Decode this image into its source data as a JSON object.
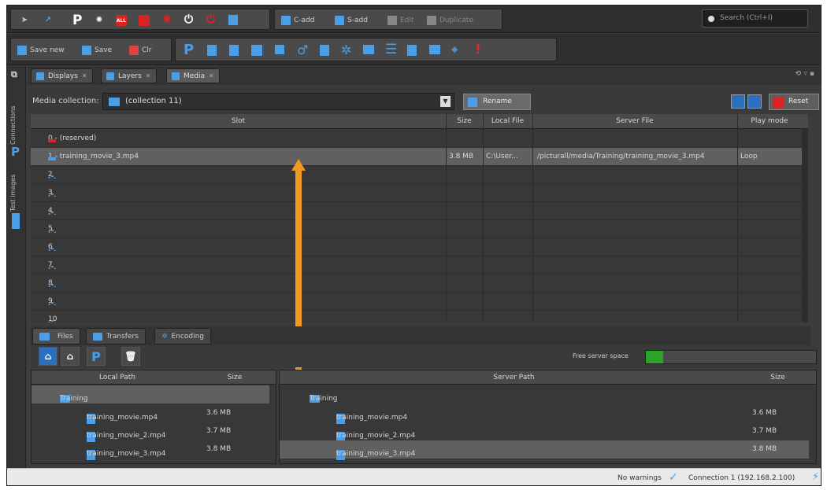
{
  "toolbar": {
    "row1_buttons": [
      "C-add",
      "S-add",
      "Edit",
      "Duplicate"
    ],
    "search_placeholder": "Search (Ctrl+I)",
    "row2_buttons": [
      "Save new",
      "Save",
      "Clr"
    ]
  },
  "sidebar": {
    "tabs": [
      "Connections",
      "Test images"
    ]
  },
  "main_tabs": [
    {
      "label": "Displays",
      "active": false
    },
    {
      "label": "Layers",
      "active": false
    },
    {
      "label": "Media",
      "active": true
    }
  ],
  "media_collection": {
    "label": "Media collection:",
    "value": "(collection 11)",
    "rename_label": "Rename",
    "reset_label": "Reset"
  },
  "slot_table": {
    "headers": [
      "Slot",
      "Size",
      "Local File",
      "Server File",
      "Play mode"
    ],
    "rows": [
      {
        "slot": "0 - (reserved)",
        "size": "",
        "local": "",
        "server": "",
        "mode": ""
      },
      {
        "slot": "1 - training_movie_3.mp4",
        "size": "3.8 MB",
        "local": "C:\\User...",
        "server": "/picturall/media/Training/training_movie_3.mp4",
        "mode": "Loop"
      },
      {
        "slot": "2",
        "size": "",
        "local": "",
        "server": "",
        "mode": ""
      },
      {
        "slot": "3",
        "size": "",
        "local": "",
        "server": "",
        "mode": ""
      },
      {
        "slot": "4",
        "size": "",
        "local": "",
        "server": "",
        "mode": ""
      },
      {
        "slot": "5",
        "size": "",
        "local": "",
        "server": "",
        "mode": ""
      },
      {
        "slot": "6",
        "size": "",
        "local": "",
        "server": "",
        "mode": ""
      },
      {
        "slot": "7",
        "size": "",
        "local": "",
        "server": "",
        "mode": ""
      },
      {
        "slot": "8",
        "size": "",
        "local": "",
        "server": "",
        "mode": ""
      },
      {
        "slot": "9",
        "size": "",
        "local": "",
        "server": "",
        "mode": ""
      },
      {
        "slot": "10",
        "size": "",
        "local": "",
        "server": "",
        "mode": ""
      }
    ]
  },
  "bottom_tabs": [
    {
      "label": "Files",
      "active": true
    },
    {
      "label": "Transfers",
      "active": false
    },
    {
      "label": "Encoding",
      "active": false
    }
  ],
  "free_space": {
    "label": "Free server space",
    "fraction": 0.1
  },
  "local_files": {
    "headers": [
      "Local Path",
      "Size"
    ],
    "folder": "Training",
    "rows": [
      {
        "name": "training_movie.mp4",
        "size": "3.6 MB"
      },
      {
        "name": "training_movie_2.mp4",
        "size": "3.7 MB"
      },
      {
        "name": "training_movie_3.mp4",
        "size": "3.8 MB"
      }
    ]
  },
  "server_files": {
    "headers": [
      "Server Path",
      "Size"
    ],
    "folder": "Training",
    "rows": [
      {
        "name": "training_movie.mp4",
        "size": "3.6 MB"
      },
      {
        "name": "training_movie_2.mp4",
        "size": "3.7 MB"
      },
      {
        "name": "training_movie_3.mp4",
        "size": "3.8 MB"
      }
    ]
  },
  "status": {
    "warnings": "No warnings",
    "connection": "Connection 1 (192.168.2.100)"
  },
  "colors": {
    "accent": "#4a9fe8",
    "annotation_arrow": "#f29a1f",
    "free_space": "#29a329"
  }
}
